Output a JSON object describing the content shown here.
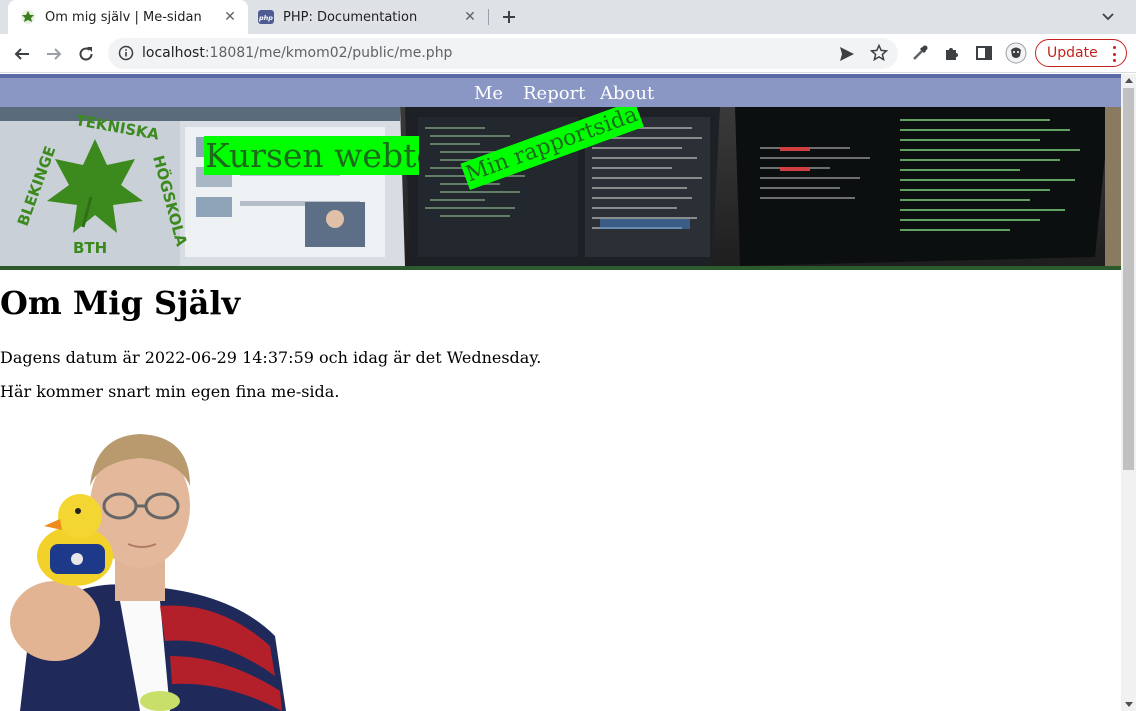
{
  "browser": {
    "tabs": [
      {
        "title": "Om mig själv | Me-sidan",
        "active": true
      },
      {
        "title": "PHP: Documentation",
        "active": false
      }
    ],
    "address": {
      "host": "localhost",
      "rest": ":18081/me/kmom02/public/me.php"
    },
    "update_label": "Update"
  },
  "site": {
    "nav": [
      "Me",
      "Report",
      "About"
    ],
    "title": "Kursen webtec",
    "slogan": "Min rapportsida",
    "logo_text": "BLEKINGE TEKNISKA HÖGSKOLA · BTH"
  },
  "page": {
    "heading": "Om Mig Själv",
    "date_text": "Dagens datum är 2022-06-29 14:37:59 och idag är det Wednesday.",
    "intro": "Här kommer snart min egen fina me-sida."
  },
  "colors": {
    "navbar": "#8a96c4",
    "title_bg": "#00ff00",
    "title_text": "#1c6b1c",
    "update": "#c5221f"
  }
}
